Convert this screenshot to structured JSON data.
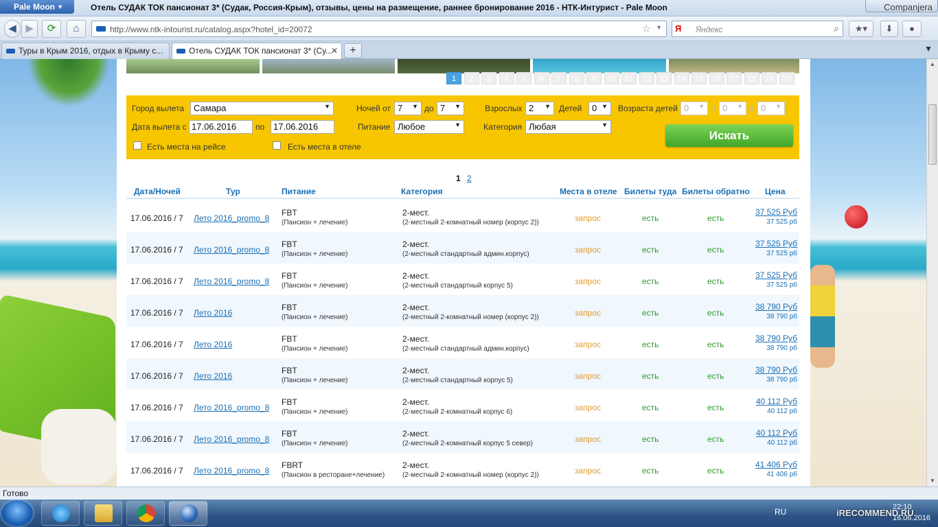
{
  "window": {
    "app_button": "Pale Moon",
    "title": "Отель СУДАК ТОК пансионат 3* (Судак, Россия-Крым), отзывы, цены на размещение, раннее бронирование 2016 - НТК-Интурист - Pale Moon",
    "corner_brand": "Companjera"
  },
  "nav": {
    "url": "http://www.ntk-intourist.ru/catalog.aspx?hotel_id=20072",
    "search_placeholder": "Яндекс",
    "search_engine_glyph": "Я"
  },
  "tabs": [
    {
      "label": "Туры в Крым 2016, отдых в Крыму с...",
      "active": false
    },
    {
      "label": "Отель СУДАК ТОК пансионат 3* (Су...",
      "active": true
    }
  ],
  "gallery": {
    "pages": [
      "1",
      "2",
      "3",
      "4",
      "5",
      "6",
      "7",
      "8",
      "9",
      "10",
      "11",
      "12",
      "13",
      "14",
      "15",
      "16",
      "17",
      "18",
      "19",
      "20"
    ],
    "active_page": "1"
  },
  "form": {
    "city_label": "Город вылета",
    "city_value": "Самара",
    "nights_label": "Ночей от",
    "nights_from": "7",
    "nights_to_label": "до",
    "nights_to": "7",
    "adults_label": "Взрослых",
    "adults_value": "2",
    "children_label": "Детей",
    "children_value": "0",
    "child_ages_label": "Возраста детей",
    "child_age_1": "0",
    "child_age_sep1": "п",
    "child_age_2": "0",
    "child_age_sep2": "п",
    "child_age_3": "0",
    "date_label": "Дата вылета с",
    "date_from": "17.06.2016",
    "date_to_label": "по",
    "date_to": "17.06.2016",
    "meal_label": "Питание",
    "meal_value": "Любое",
    "category_label": "Категория",
    "category_value": "Любая",
    "flight_seats_label": "Есть места на рейсе",
    "hotel_seats_label": "Есть места в отеле",
    "search_button": "Искать"
  },
  "pagination": {
    "current": "1",
    "other": "2"
  },
  "table": {
    "headers": {
      "date": "Дата/Ночей",
      "tour": "Тур",
      "meal": "Питание",
      "category": "Категория",
      "hotel_seats": "Места в отеле",
      "tickets_there": "Билеты туда",
      "tickets_back": "Билеты обратно",
      "price": "Цена"
    },
    "rows": [
      {
        "date": "17.06.2016 / 7",
        "tour": "Лето 2016_promo_8",
        "meal": "FBT",
        "meal_desc": "(Пансион + лечение)",
        "cat": "2-мест.",
        "cat_desc": "(2-местный 2-комнатный номер (корпус 2))",
        "hotel": "запрос",
        "there": "есть",
        "back": "есть",
        "price": "37 525 Руб",
        "price_sub": "37 525 рб"
      },
      {
        "date": "17.06.2016 / 7",
        "tour": "Лето 2016_promo_8",
        "meal": "FBT",
        "meal_desc": "(Пансион + лечение)",
        "cat": "2-мест.",
        "cat_desc": "(2-местный стандартный админ.корпус)",
        "hotel": "запрос",
        "there": "есть",
        "back": "есть",
        "price": "37 525 Руб",
        "price_sub": "37 525 рб"
      },
      {
        "date": "17.06.2016 / 7",
        "tour": "Лето 2016_promo_8",
        "meal": "FBT",
        "meal_desc": "(Пансион + лечение)",
        "cat": "2-мест.",
        "cat_desc": "(2-местный стандартный корпус 5)",
        "hotel": "запрос",
        "there": "есть",
        "back": "есть",
        "price": "37 525 Руб",
        "price_sub": "37 525 рб"
      },
      {
        "date": "17.06.2016 / 7",
        "tour": "Лето 2016",
        "meal": "FBT",
        "meal_desc": "(Пансион + лечение)",
        "cat": "2-мест.",
        "cat_desc": "(2-местный 2-комнатный номер (корпус 2))",
        "hotel": "запрос",
        "there": "есть",
        "back": "есть",
        "price": "38 790 Руб",
        "price_sub": "38 790 рб"
      },
      {
        "date": "17.06.2016 / 7",
        "tour": "Лето 2016",
        "meal": "FBT",
        "meal_desc": "(Пансион + лечение)",
        "cat": "2-мест.",
        "cat_desc": "(2-местный стандартный админ.корпус)",
        "hotel": "запрос",
        "there": "есть",
        "back": "есть",
        "price": "38 790 Руб",
        "price_sub": "38 790 рб"
      },
      {
        "date": "17.06.2016 / 7",
        "tour": "Лето 2016",
        "meal": "FBT",
        "meal_desc": "(Пансион + лечение)",
        "cat": "2-мест.",
        "cat_desc": "(2-местный стандартный корпус 5)",
        "hotel": "запрос",
        "there": "есть",
        "back": "есть",
        "price": "38 790 Руб",
        "price_sub": "38 790 рб"
      },
      {
        "date": "17.06.2016 / 7",
        "tour": "Лето 2016_promo_8",
        "meal": "FBT",
        "meal_desc": "(Пансион + лечение)",
        "cat": "2-мест.",
        "cat_desc": "(2-местный 2-комнатный корпус 6)",
        "hotel": "запрос",
        "there": "есть",
        "back": "есть",
        "price": "40 112 Руб",
        "price_sub": "40 112 рб"
      },
      {
        "date": "17.06.2016 / 7",
        "tour": "Лето 2016_promo_8",
        "meal": "FBT",
        "meal_desc": "(Пансион + лечение)",
        "cat": "2-мест.",
        "cat_desc": "(2-местный 2-комнатный корпус 5 север)",
        "hotel": "запрос",
        "there": "есть",
        "back": "есть",
        "price": "40 112 Руб",
        "price_sub": "40 112 рб"
      },
      {
        "date": "17.06.2016 / 7",
        "tour": "Лето 2016_promo_8",
        "meal": "FBRT",
        "meal_desc": "(Пансион в ресторане+лечение)",
        "cat": "2-мест.",
        "cat_desc": "(2-местный 2-комнатный номер (корпус 2))",
        "hotel": "запрос",
        "there": "есть",
        "back": "есть",
        "price": "41 406 Руб",
        "price_sub": "41 406 рб"
      }
    ]
  },
  "status": {
    "text": "Готово"
  },
  "taskbar": {
    "lang": "RU",
    "time": "22:10",
    "date": "16.06.2016",
    "watermark": "iRECOMMEND.RU"
  },
  "colors": {
    "form_bg": "#f7c600",
    "search_button": "#3fa62a",
    "link": "#1a6fb4",
    "status_request": "#e39a2d",
    "status_available": "#2e9b2e"
  }
}
